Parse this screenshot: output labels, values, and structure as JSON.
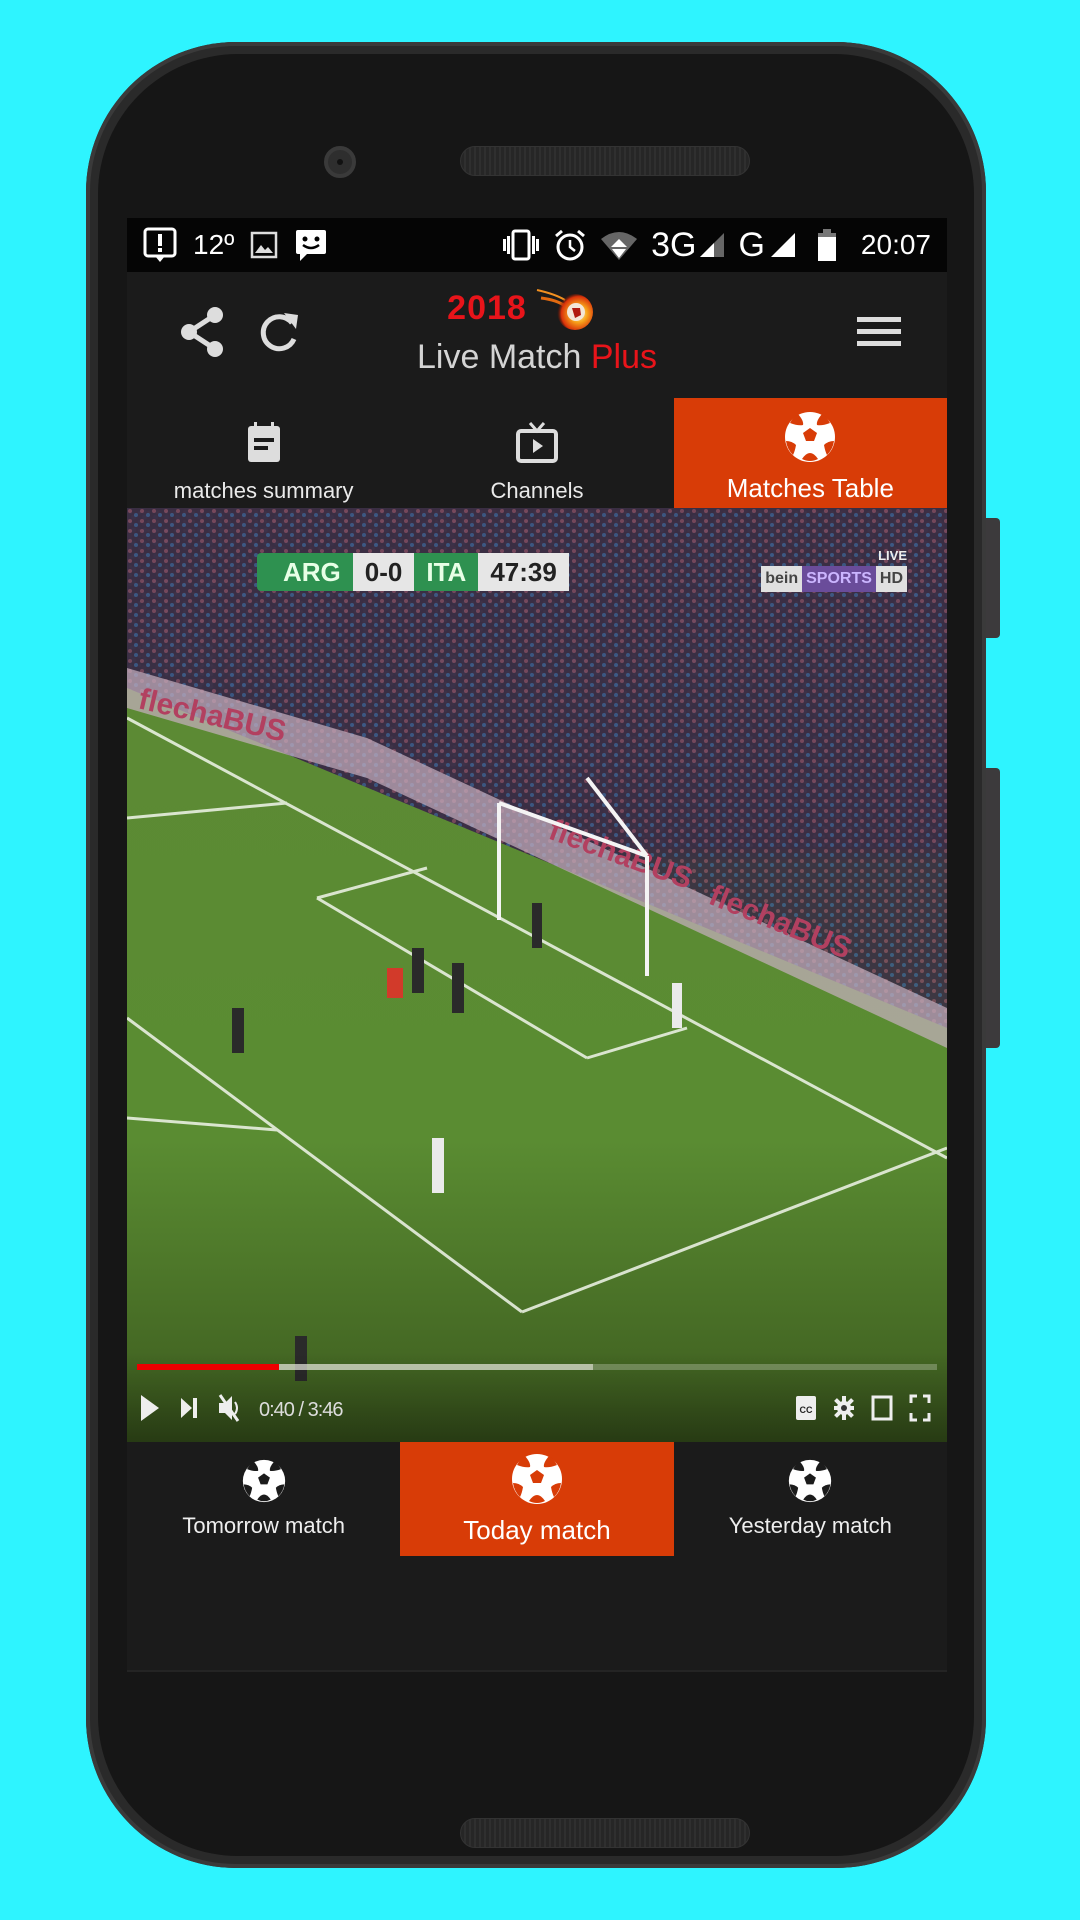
{
  "status_bar": {
    "temperature": "12º",
    "network_primary": "3G",
    "network_secondary": "G",
    "time": "20:07",
    "icons_left": [
      "alert-notification-icon",
      "image-icon",
      "message-icon"
    ],
    "icons_right": [
      "vibrate-icon",
      "alarm-icon",
      "wifi-icon",
      "signal-icon",
      "signal-icon",
      "battery-icon"
    ]
  },
  "app_bar": {
    "logo_year": "2018",
    "logo_title": "Live Match",
    "logo_title_accent": "Plus",
    "accent_color": "#e8141a"
  },
  "top_tabs": [
    {
      "label": "matches summary",
      "icon": "calendar-icon",
      "active": false
    },
    {
      "label": "Channels",
      "icon": "tv-icon",
      "active": false
    },
    {
      "label": "Matches Table",
      "icon": "soccer-ball-icon",
      "active": true
    }
  ],
  "video": {
    "scorebug": {
      "home": "ARG",
      "score": "0-0",
      "away": "ITA",
      "clock": "47:39"
    },
    "channel": {
      "brand": "bein",
      "sports": "SPORTS",
      "hd": "HD",
      "live": "LIVE"
    },
    "player": {
      "current_time": "0:40",
      "duration": "3:46",
      "time_display": "0:40 / 3:46",
      "played_fraction": 0.177,
      "buffered_fraction": 0.57
    }
  },
  "bottom_tabs": [
    {
      "label": "Tomorrow match",
      "icon": "soccer-ball-icon",
      "active": false
    },
    {
      "label": "Today match",
      "icon": "soccer-ball-icon",
      "active": true
    },
    {
      "label": "Yesterday match",
      "icon": "soccer-ball-icon",
      "active": false
    }
  ],
  "colors": {
    "active_tab": "#d83c07",
    "background": "#1b1b1b",
    "page_background": "#2ef4ff",
    "progress_played": "#ee0000"
  }
}
